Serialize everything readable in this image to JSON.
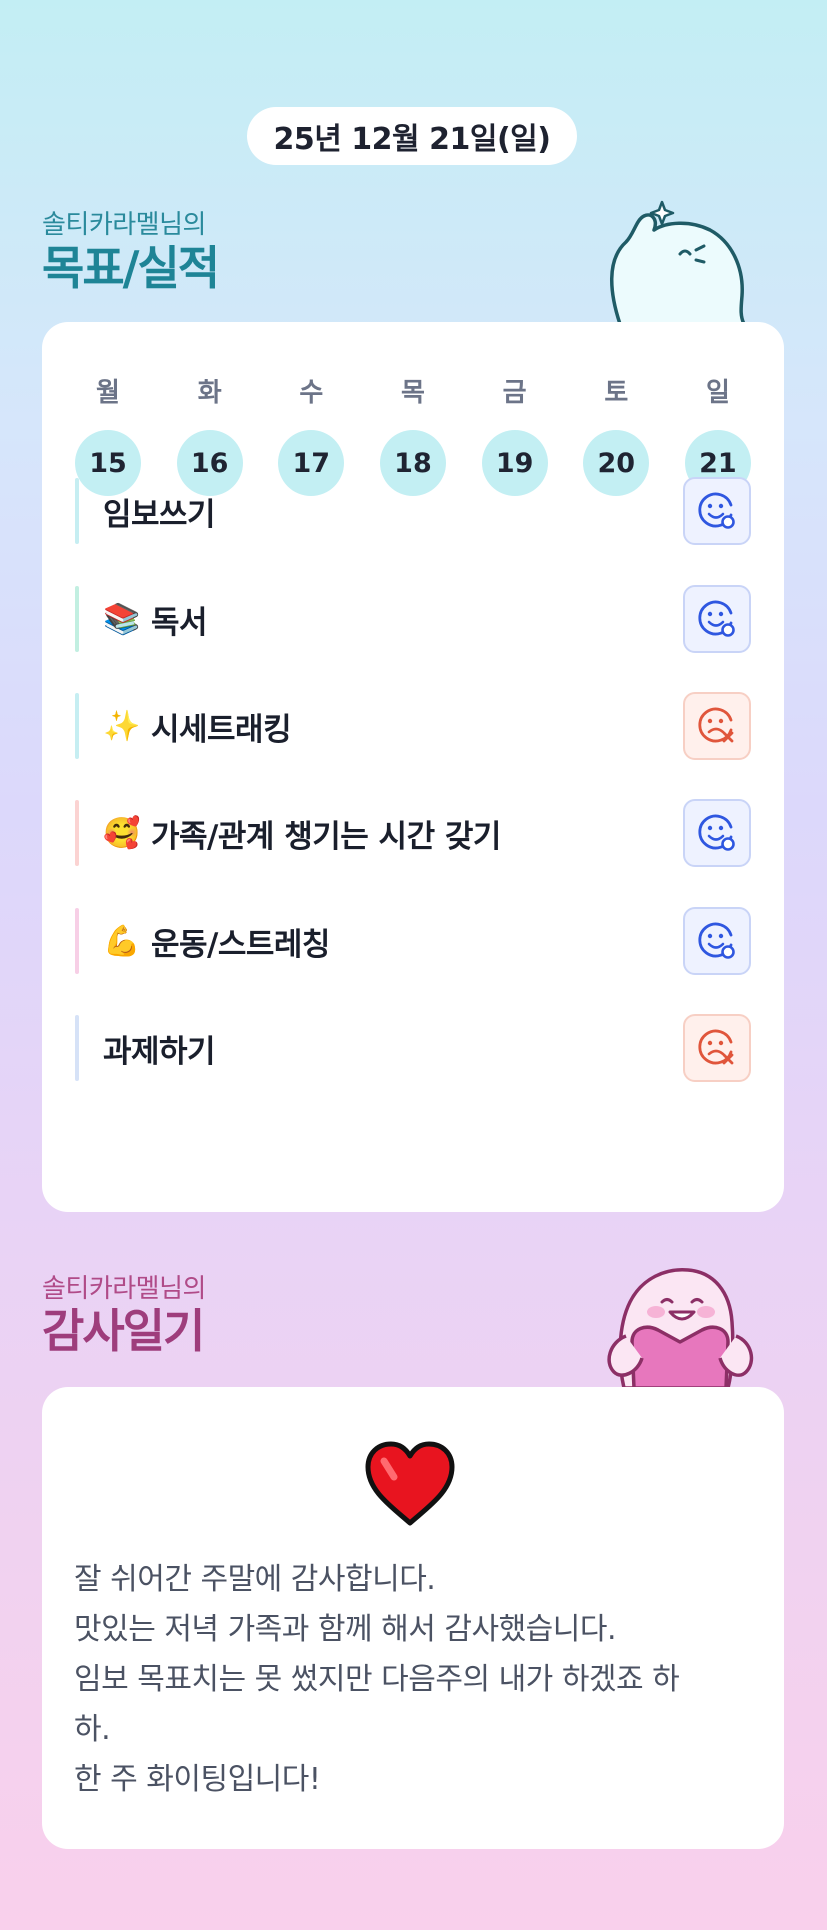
{
  "header": {
    "date": "25년 12월 21일(일)"
  },
  "goals_section": {
    "subtitle": "솔티카라멜님의",
    "title": "목표/실적",
    "weekdays": [
      "월",
      "화",
      "수",
      "목",
      "금",
      "토",
      "일"
    ],
    "days": [
      "15",
      "16",
      "17",
      "18",
      "19",
      "20",
      "21"
    ],
    "items": [
      {
        "emoji": "",
        "label": "임보쓰기",
        "status": "smile-check",
        "bar_color": "#c6eef2"
      },
      {
        "emoji": "📚",
        "label": "독서",
        "status": "smile-check",
        "bar_color": "#c2efe1"
      },
      {
        "emoji": "✨",
        "label": "시세트래킹",
        "status": "sad-x",
        "bar_color": "#c6eef2"
      },
      {
        "emoji": "🥰",
        "label": "가족/관계 챙기는 시간 갖기",
        "status": "smile-check",
        "bar_color": "#fbd3d2"
      },
      {
        "emoji": "💪",
        "label": "운동/스트레칭",
        "status": "smile-check",
        "bar_color": "#f7cfe6"
      },
      {
        "emoji": "",
        "label": "과제하기",
        "status": "sad-x",
        "bar_color": "#d6e2f7"
      }
    ]
  },
  "gratitude_section": {
    "subtitle": "솔티카라멜님의",
    "title": "감사일기",
    "text": "잘 쉬어간 주말에 감사합니다.\n맛있는 저녁 가족과 함께 해서 감사했습니다.\n임보 목표치는 못 썼지만 다음주의 내가 하겠죠 하\n하.\n한 주 화이팅입니다!"
  },
  "colors": {
    "ok_icon": "#2f57e0",
    "fail_icon": "#e0553b",
    "day_circle": "#c3eff3"
  }
}
